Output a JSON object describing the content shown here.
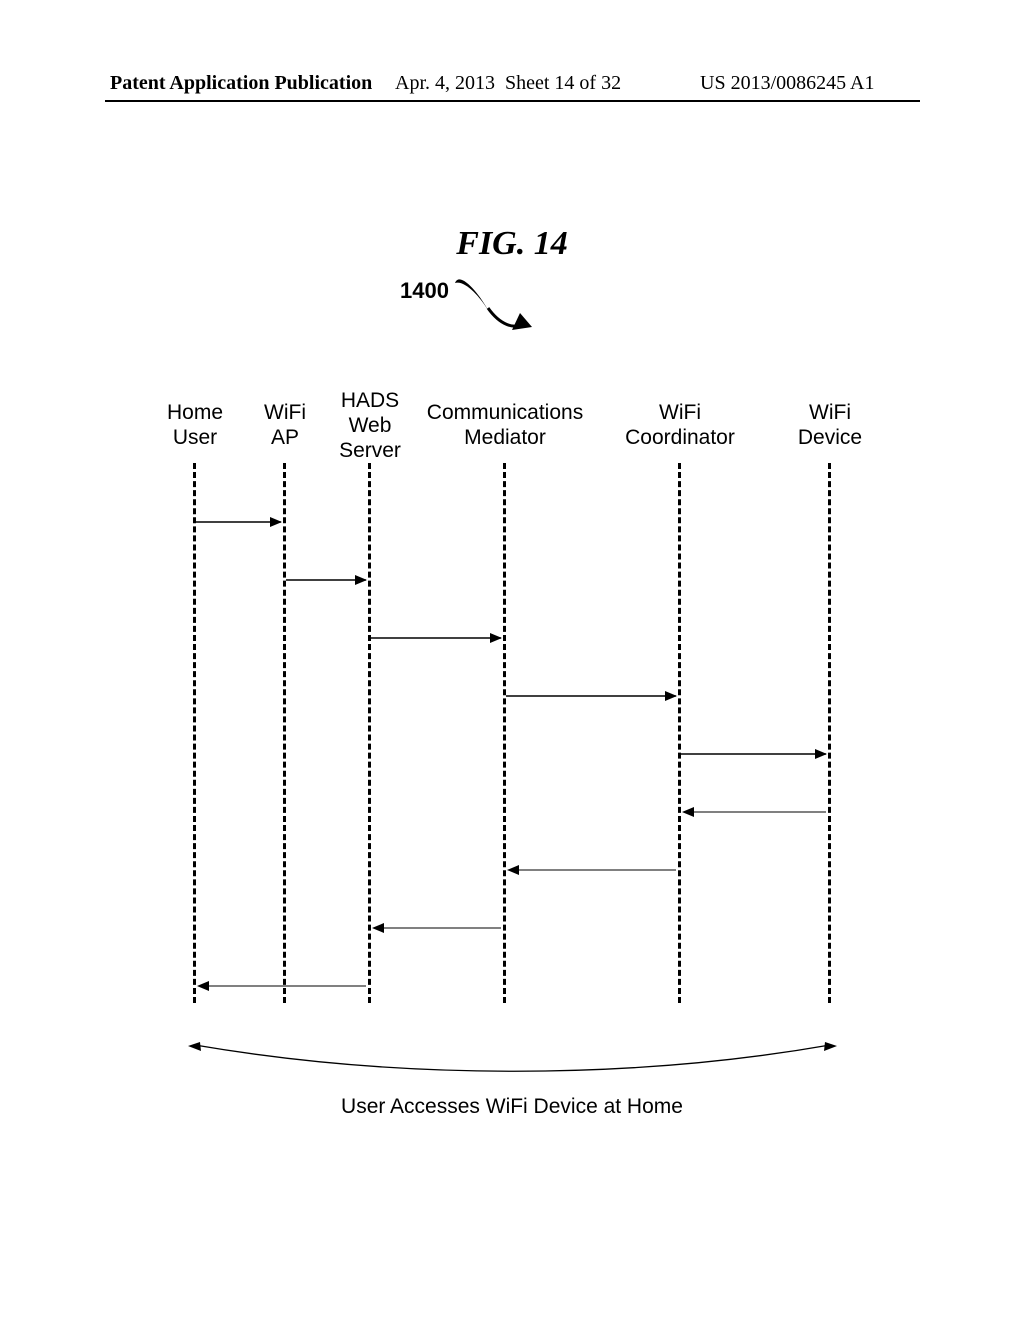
{
  "header": {
    "left": "Patent Application Publication",
    "mid_date": "Apr. 4, 2013",
    "mid_sheet": "Sheet 14 of 32",
    "right": "US 2013/0086245 A1"
  },
  "figure": {
    "title": "FIG. 14",
    "ref_number": "1400"
  },
  "lifelines": {
    "home_user": "Home\nUser",
    "wifi_ap": "WiFi\nAP",
    "hads_web_server": "HADS\nWeb\nServer",
    "comm_mediator": "Communications\nMediator",
    "wifi_coordinator": "WiFi\nCoordinator",
    "wifi_device": "WiFi\nDevice"
  },
  "caption": "User Accesses WiFi Device at Home",
  "chart_data": {
    "type": "sequence_diagram",
    "participants": [
      "Home User",
      "WiFi AP",
      "HADS Web Server",
      "Communications Mediator",
      "WiFi Coordinator",
      "WiFi Device"
    ],
    "messages": [
      {
        "from": "Home User",
        "to": "WiFi AP"
      },
      {
        "from": "WiFi AP",
        "to": "HADS Web Server"
      },
      {
        "from": "HADS Web Server",
        "to": "Communications Mediator"
      },
      {
        "from": "Communications Mediator",
        "to": "WiFi Coordinator"
      },
      {
        "from": "WiFi Coordinator",
        "to": "WiFi Device"
      },
      {
        "from": "WiFi Device",
        "to": "WiFi Coordinator"
      },
      {
        "from": "WiFi Coordinator",
        "to": "Communications Mediator"
      },
      {
        "from": "Communications Mediator",
        "to": "HADS Web Server"
      },
      {
        "from": "HADS Web Server",
        "to": "Home User"
      }
    ],
    "title": "User Accesses WiFi Device at Home"
  }
}
